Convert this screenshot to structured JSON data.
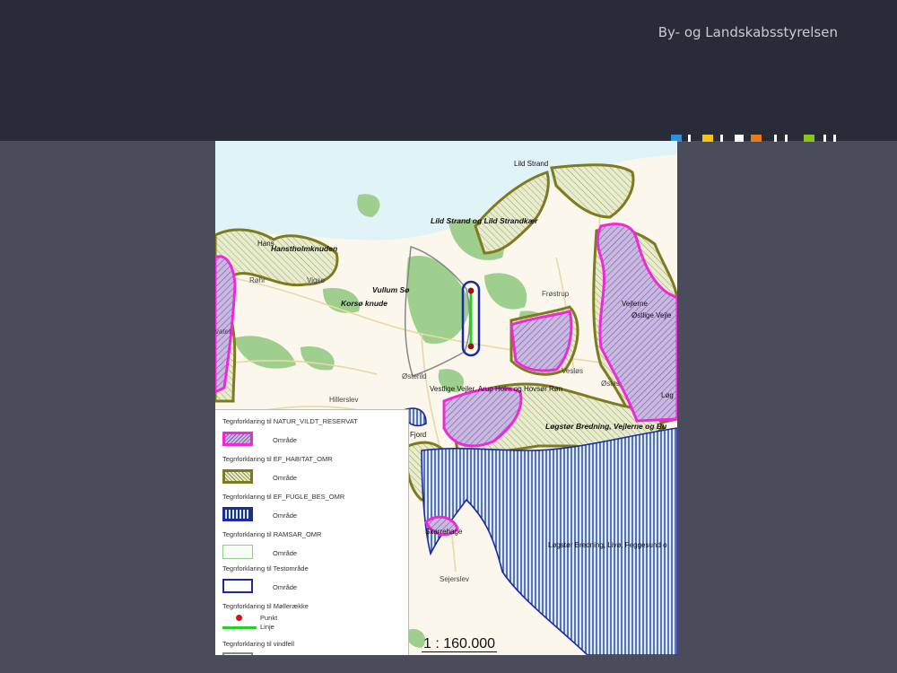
{
  "header": {
    "brand": "By- og Landskabsstyrelsen"
  },
  "brand_colors": [
    "#2f8fd8",
    "#f2c318",
    "#ffffff",
    "#ea7b1c",
    "#ffffff",
    "#8cc21e",
    "#ffffff"
  ],
  "map": {
    "scale": "1 : 160.000",
    "places": {
      "lild_strand": "Lild Strand",
      "lild_strand_kaer": "Lild Strand og Lild Strandkær",
      "hanstholm": "Hanstholmknuden",
      "hanst": "Hans",
      "roehr": "Røhr",
      "vigso": "Vigsø",
      "vullum": "Vullum Sø",
      "korso": "Korsø knude",
      "frostrup": "Frøstrup",
      "vejlerne": "Vejlerne",
      "ostlige": "Østlige Vejle",
      "osterild": "Østerild",
      "vesloes": "Vesløs",
      "oslos": "Øsløs",
      "vestlige": "Vestlige Vejler, Arup Holm og Hovsør Røn",
      "loegstoer1": "Løgstør Bredning, Vejlerne og Bu",
      "log": "Løg",
      "hillerslev": "Hillerslev",
      "vatet": "vatet",
      "fjord": "Fjord",
      "skarrehage": "Skarrehage",
      "sejerslev": "Sejerslev",
      "loegstoer2": "Løgstør Bredning, Livø, Feggesund o"
    }
  },
  "legend": [
    {
      "heading": "Tegnforklaring til NATUR_VILDT_RESERVAT",
      "label": "Område"
    },
    {
      "heading": "Tegnforklaring til EF_HABITAT_OMR",
      "label": "Område"
    },
    {
      "heading": "Tegnforklaring til EF_FUGLE_BES_OMR",
      "label": "Område"
    },
    {
      "heading": "Tegnforklaring til RAMSAR_OMR",
      "label": "Område"
    },
    {
      "heading": "Tegnforklaring til Testområde",
      "label": "Område"
    },
    {
      "heading": "Tegnforklaring til Møllerække",
      "label_punkt": "Punkt",
      "label_linje": "Linje"
    },
    {
      "heading": "Tegnforklaring til vindfell"
    }
  ]
}
